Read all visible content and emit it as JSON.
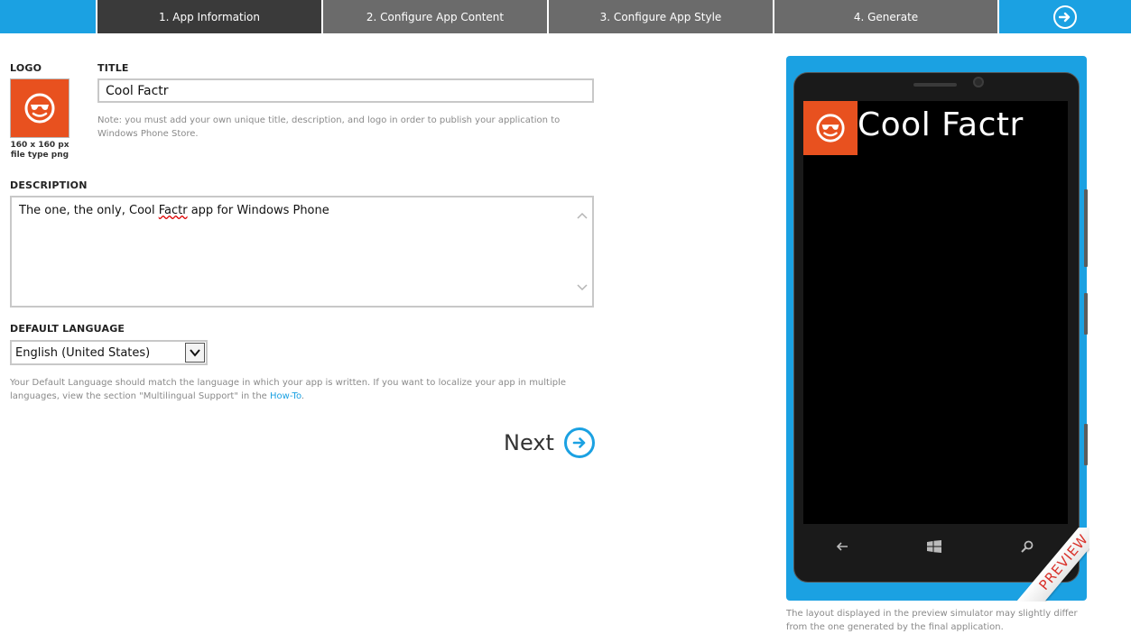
{
  "steps": [
    {
      "label": "1. App Information",
      "active": true
    },
    {
      "label": "2. Configure App Content",
      "active": false
    },
    {
      "label": "3. Configure App Style",
      "active": false
    },
    {
      "label": "4. Generate",
      "active": false
    }
  ],
  "form": {
    "logo_label": "LOGO",
    "logo_icon": "sunglasses-smiley-icon",
    "logo_caption_line1": "160 x 160 px",
    "logo_caption_line2": "file type png",
    "title_label": "TITLE",
    "title_value": "Cool Factr",
    "title_note": "Note: you must add your own unique title, description, and logo in order to publish your application to Windows Phone Store.",
    "description_label": "DESCRIPTION",
    "description_before": "The one, the only, Cool ",
    "description_spell": "Factr",
    "description_after": " app for Windows Phone",
    "language_label": "DEFAULT LANGUAGE",
    "language_value": "English (United States)",
    "language_note_before": "Your Default Language should match the language in which your app is written. If you want to localize your app in multiple languages, view the section \"Multilingual Support\" in the ",
    "language_note_link": "How-To",
    "language_note_after": ".",
    "next_label": "Next"
  },
  "preview": {
    "app_title": "Cool Factr",
    "ribbon_text": "PREVIEW",
    "note": "The layout displayed in the preview simulator may slightly differ from the one generated by the final application."
  },
  "colors": {
    "accent": "#1ba1e2",
    "logo_orange": "#e8511f",
    "step_active": "#3a3a3a",
    "step_inactive": "#6b6b6b"
  }
}
